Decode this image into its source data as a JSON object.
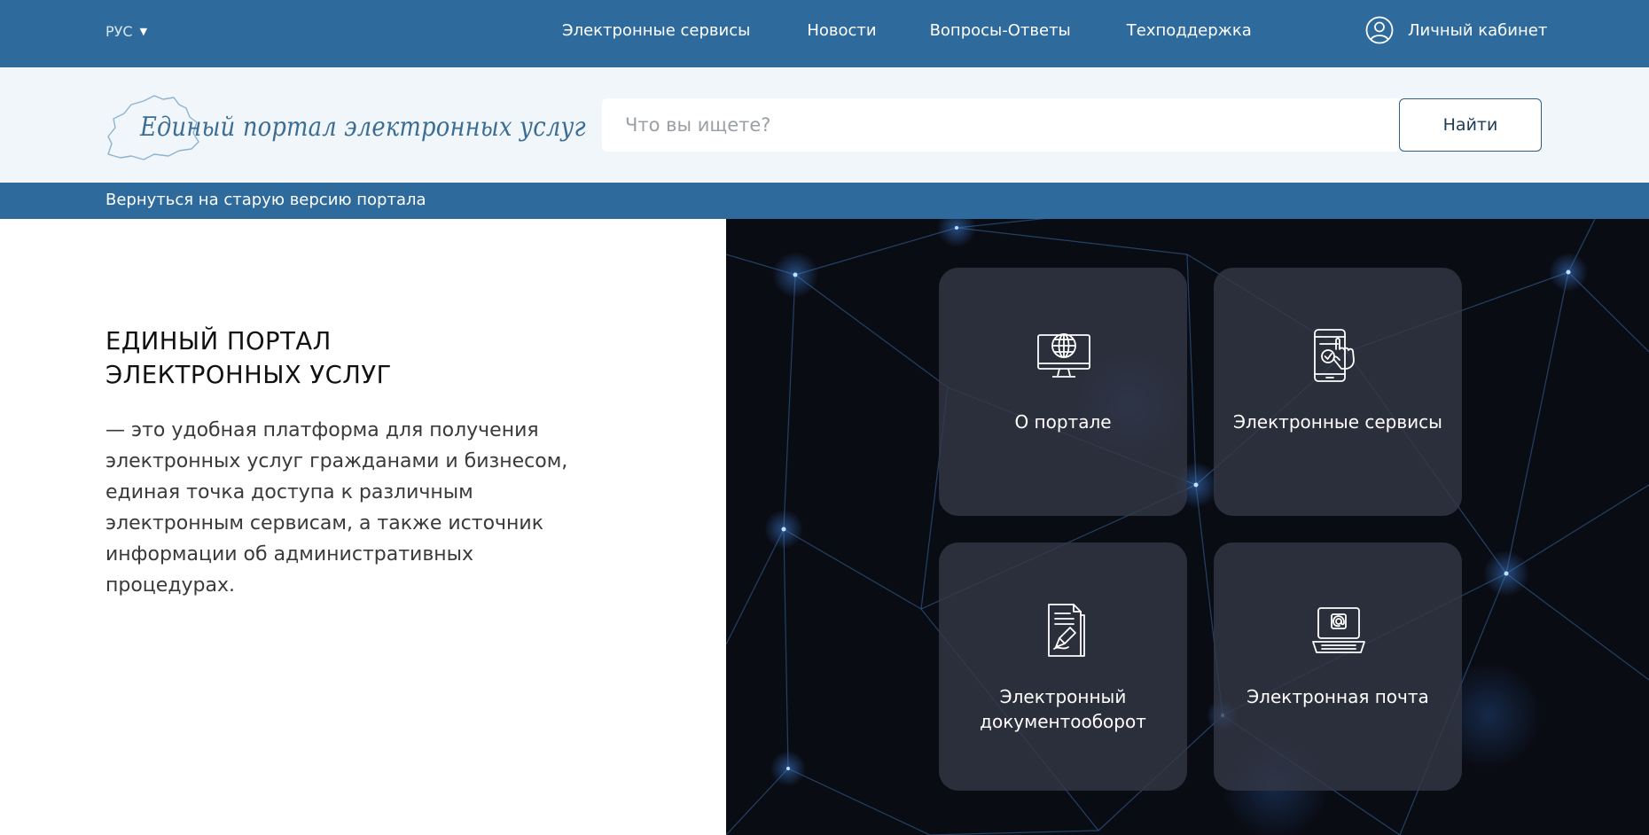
{
  "topbar": {
    "language": "РУС",
    "nav": [
      {
        "label": "Электронные сервисы"
      },
      {
        "label": "Новости"
      },
      {
        "label": "Вопросы-Ответы"
      },
      {
        "label": "Техподдержка"
      }
    ],
    "cabinet_label": "Личный кабинет"
  },
  "header": {
    "logo_text": "Единый портал электронных услуг",
    "search_placeholder": "Что вы ищете?",
    "search_button": "Найти"
  },
  "old_version_link": "Вернуться на старую версию портала",
  "intro": {
    "title_line1": "ЕДИНЫЙ ПОРТАЛ",
    "title_line2": "ЭЛЕКТРОННЫХ УСЛУГ",
    "description": "— это удобная платформа для получения электронных услуг гражданами и бизнесом, единая точка доступа к различным электронным сервисам, а также источник информации об административных процедурах."
  },
  "tiles": [
    {
      "label": "О портале",
      "icon": "globe-monitor-icon"
    },
    {
      "label": "Электронные сервисы",
      "icon": "phone-touch-icon"
    },
    {
      "label_line1": "Электронный",
      "label_line2": "документооборот",
      "icon": "document-pen-icon"
    },
    {
      "label": "Электронная почта",
      "icon": "laptop-mail-icon"
    }
  ],
  "colors": {
    "brand_blue": "#2e6b9c",
    "header_bg": "#f0f6f9",
    "panel_bg": "#0a0c14",
    "tile_bg": "#343846"
  }
}
